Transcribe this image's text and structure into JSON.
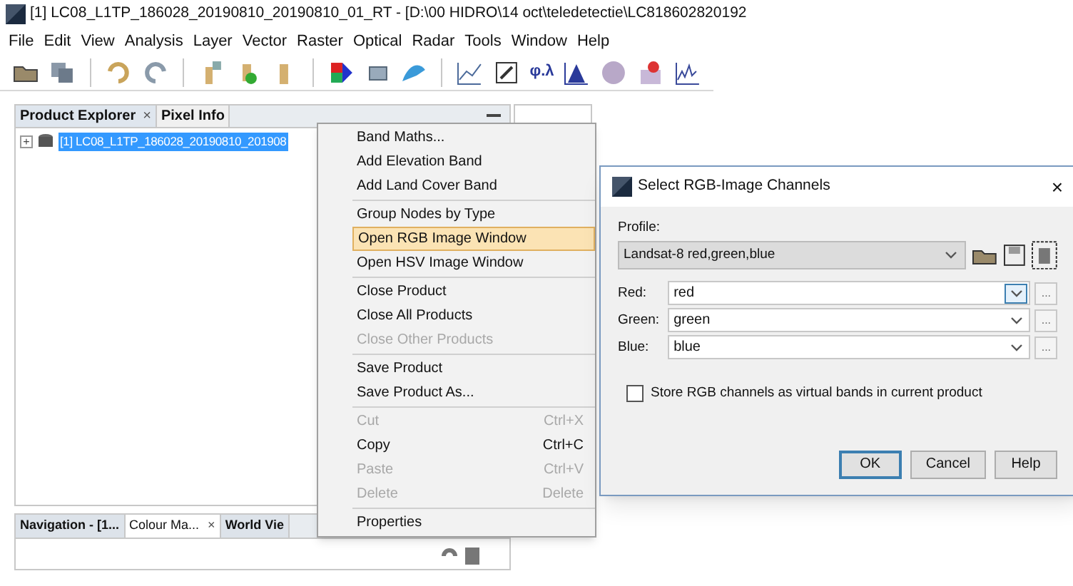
{
  "window": {
    "title": "[1] LC08_L1TP_186028_20190810_20190810_01_RT - [D:\\00 HIDRO\\14 oct\\teledetectie\\LC818602820192"
  },
  "menu_bar": [
    "File",
    "Edit",
    "View",
    "Analysis",
    "Layer",
    "Vector",
    "Raster",
    "Optical",
    "Radar",
    "Tools",
    "Window",
    "Help"
  ],
  "toolbar": {
    "text_button": "φ.λ"
  },
  "top_panel": {
    "tabs": [
      {
        "label": "Product Explorer",
        "selected": true,
        "close": "×"
      },
      {
        "label": "Pixel Info",
        "selected": false
      }
    ],
    "tree": [
      {
        "toggle": "+",
        "label": "[1] LC08_L1TP_186028_20190810_201908",
        "selected": true
      }
    ]
  },
  "bottom_panel": {
    "tabs": [
      {
        "label": "Navigation - [1...",
        "selected": false
      },
      {
        "label": "Colour Ma...",
        "selected": true,
        "close": "×"
      },
      {
        "label": "World Vie",
        "selected": false
      }
    ]
  },
  "context_menu": [
    {
      "kind": "item",
      "label": "Band Maths...",
      "disabled": false,
      "selected": false
    },
    {
      "kind": "item",
      "label": "Add Elevation Band",
      "disabled": false,
      "selected": false
    },
    {
      "kind": "item",
      "label": "Add Land Cover Band",
      "disabled": false,
      "selected": false
    },
    {
      "kind": "separator"
    },
    {
      "kind": "item",
      "label": "Group Nodes by Type",
      "disabled": false,
      "selected": false
    },
    {
      "kind": "item",
      "label": "Open RGB Image Window",
      "disabled": false,
      "selected": true
    },
    {
      "kind": "item",
      "label": "Open HSV Image Window",
      "disabled": false,
      "selected": false
    },
    {
      "kind": "separator"
    },
    {
      "kind": "item",
      "label": "Close Product",
      "disabled": false,
      "selected": false
    },
    {
      "kind": "item",
      "label": "Close All Products",
      "disabled": false,
      "selected": false
    },
    {
      "kind": "item",
      "label": "Close Other Products",
      "disabled": true,
      "selected": false
    },
    {
      "kind": "separator"
    },
    {
      "kind": "item",
      "label": "Save Product",
      "disabled": false,
      "selected": false
    },
    {
      "kind": "item",
      "label": "Save Product As...",
      "disabled": false,
      "selected": false
    },
    {
      "kind": "separator"
    },
    {
      "kind": "item",
      "label": "Cut",
      "shortcut": "Ctrl+X",
      "disabled": true,
      "selected": false
    },
    {
      "kind": "item",
      "label": "Copy",
      "shortcut": "Ctrl+C",
      "disabled": false,
      "selected": false
    },
    {
      "kind": "item",
      "label": "Paste",
      "shortcut": "Ctrl+V",
      "disabled": true,
      "selected": false
    },
    {
      "kind": "item",
      "label": "Delete",
      "shortcut": "Delete",
      "disabled": true,
      "selected": false
    },
    {
      "kind": "separator"
    },
    {
      "kind": "item",
      "label": "Properties",
      "disabled": false,
      "selected": false
    }
  ],
  "dialog": {
    "title": "Select RGB-Image Channels",
    "close": "×",
    "profile_label": "Profile:",
    "profile": "Landsat-8 red,green,blue",
    "channels": [
      {
        "label": "Red:",
        "value": "red",
        "focused": true,
        "more": "..."
      },
      {
        "label": "Green:",
        "value": "green",
        "focused": false,
        "more": "..."
      },
      {
        "label": "Blue:",
        "value": "blue",
        "focused": false,
        "more": "..."
      }
    ],
    "checkbox": {
      "label": "Store RGB channels as virtual bands in current product",
      "checked": false
    },
    "buttons": [
      {
        "label": "OK",
        "default": true
      },
      {
        "label": "Cancel",
        "default": false
      },
      {
        "label": "Help",
        "default": false
      }
    ]
  }
}
